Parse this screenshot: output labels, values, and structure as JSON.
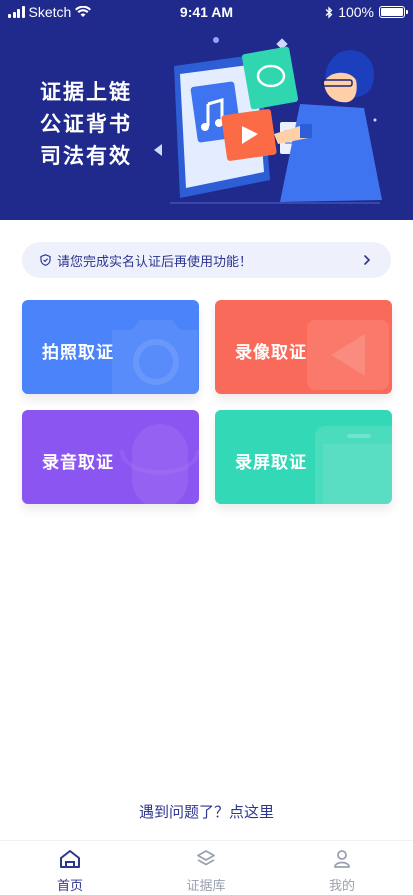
{
  "status_bar": {
    "carrier": "Sketch",
    "time": "9:41 AM",
    "battery": "100%"
  },
  "banner": {
    "lines": [
      "证据上链",
      "公证背书",
      "司法有效"
    ]
  },
  "notice": {
    "text": "请您完成实名认证后再使用功能！"
  },
  "cards": [
    {
      "label": "拍照取证",
      "color": "#4a83fa"
    },
    {
      "label": "录像取证",
      "color": "#fa6a5a"
    },
    {
      "label": "录音取证",
      "color": "#8b55f1"
    },
    {
      "label": "录屏取证",
      "color": "#33d8b6"
    }
  ],
  "help_link": "遇到问题了？点这里",
  "tabs": [
    {
      "label": "首页",
      "icon": "home-icon",
      "active": true
    },
    {
      "label": "证据库",
      "icon": "layers-icon",
      "active": false
    },
    {
      "label": "我的",
      "icon": "person-icon",
      "active": false
    }
  ],
  "colors": {
    "primary": "#2c3590",
    "banner": "#1f2a8c",
    "notice_bg": "#eef0fb"
  }
}
